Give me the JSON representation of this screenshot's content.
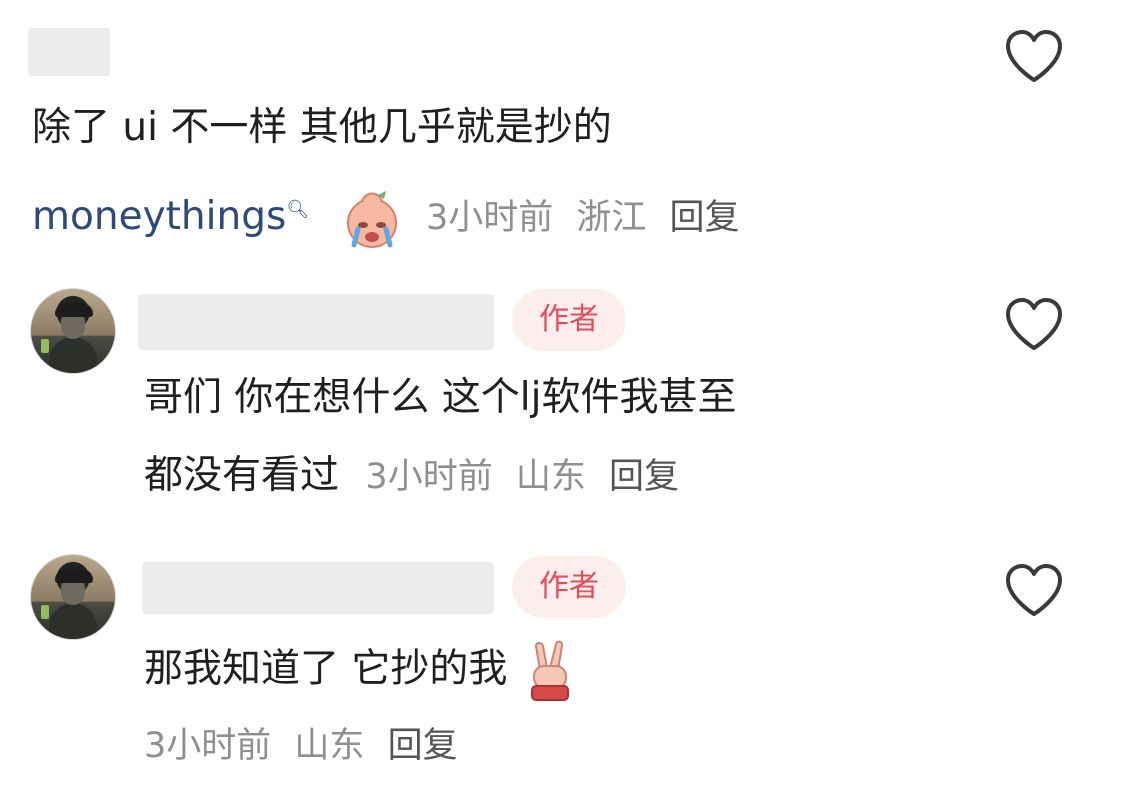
{
  "comments": [
    {
      "name_hidden": true,
      "text": "除了 ui 不一样 其他几乎就是抄的",
      "mention": "moneythings",
      "mention_suffix": "ᵠ",
      "emoji": "crying-face-emoji",
      "time": "3小时前",
      "location": "浙江",
      "reply": "回复"
    },
    {
      "name_hidden": true,
      "badge": "作者",
      "text_line1": "哥们 你在想什么 这个lj软件我甚至",
      "text_line2": "都没有看过",
      "time": "3小时前",
      "location": "山东",
      "reply": "回复"
    },
    {
      "name_hidden": true,
      "badge": "作者",
      "text": "那我知道了 它抄的我",
      "emoji": "peace-hand-emoji",
      "time": "3小时前",
      "location": "山东",
      "reply": "回复"
    }
  ],
  "icons": {
    "like": "heart-outline-icon"
  },
  "colors": {
    "badge_text": "#e34c59",
    "badge_bg": "#fdeeee",
    "mention": "#2f4a7a",
    "meta": "#8f8f8f"
  }
}
